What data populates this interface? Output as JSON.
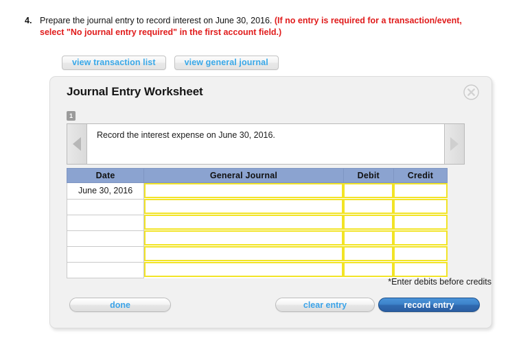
{
  "question": {
    "number": "4.",
    "text_black": "Prepare the journal entry to record interest on June 30, 2016.",
    "text_red": "(If no entry is required for a transaction/event, select \"No journal entry required\" in the first account field.)"
  },
  "view_buttons": [
    {
      "label": "view transaction list",
      "name": "view-transaction-list-button"
    },
    {
      "label": "view general journal",
      "name": "view-general-journal-button"
    }
  ],
  "dialog": {
    "title": "Journal Entry Worksheet",
    "close_icon": "close-icon",
    "badge": "1",
    "prompt": "Record the interest expense on June 30, 2016.",
    "prev_icon": "chevron-left-icon",
    "next_icon": "chevron-right-icon",
    "hint": "*Enter debits before credits",
    "table": {
      "headers": [
        "Date",
        "General Journal",
        "Debit",
        "Credit"
      ],
      "rows": [
        {
          "date": "June 30, 2016",
          "general_journal": "",
          "debit": "",
          "credit": ""
        },
        {
          "date": "",
          "general_journal": "",
          "debit": "",
          "credit": ""
        },
        {
          "date": "",
          "general_journal": "",
          "debit": "",
          "credit": ""
        },
        {
          "date": "",
          "general_journal": "",
          "debit": "",
          "credit": ""
        },
        {
          "date": "",
          "general_journal": "",
          "debit": "",
          "credit": ""
        },
        {
          "date": "",
          "general_journal": "",
          "debit": "",
          "credit": ""
        }
      ]
    },
    "actions": {
      "done": "done",
      "clear": "clear entry",
      "record": "record entry"
    }
  },
  "colors": {
    "red_text": "#e01b1b",
    "link_blue": "#3ba3e8",
    "header_blue": "#8ba3d0",
    "input_yellow": "#f2e426",
    "record_blue": "#2f6ab0"
  }
}
